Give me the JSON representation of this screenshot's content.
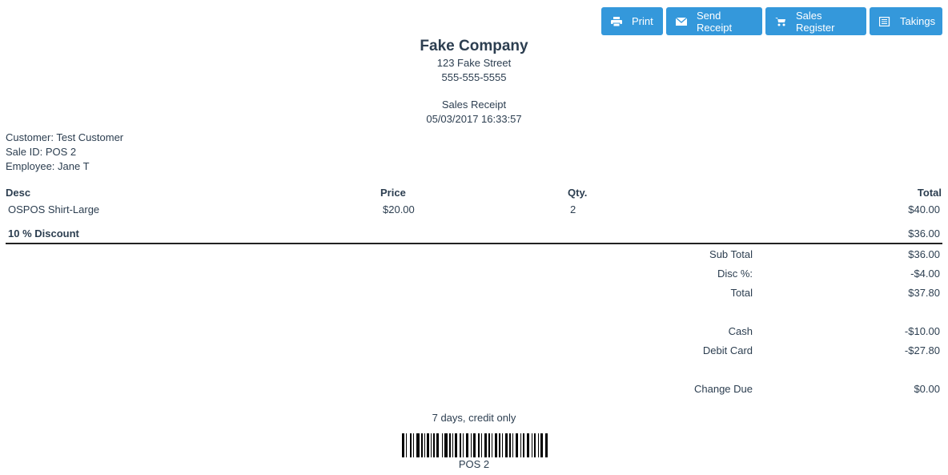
{
  "toolbar": {
    "print": {
      "label": "Print",
      "icon": "print-icon"
    },
    "send_receipt": {
      "label": "Send Receipt",
      "icon": "envelope-icon"
    },
    "sales_register": {
      "label": "Sales Register",
      "icon": "cart-icon"
    },
    "takings": {
      "label": "Takings",
      "icon": "list-icon"
    }
  },
  "company": {
    "name": "Fake Company",
    "address": "123 Fake Street",
    "phone": "555-555-5555"
  },
  "receipt": {
    "title": "Sales Receipt",
    "datetime": "05/03/2017 16:33:57"
  },
  "customer_info": {
    "customer": "Customer: Test Customer",
    "sale_id": "Sale ID: POS 2",
    "employee": "Employee: Jane T"
  },
  "table": {
    "headers": {
      "desc": "Desc",
      "price": "Price",
      "qty": "Qty.",
      "total": "Total"
    },
    "item": {
      "desc": "OSPOS Shirt-Large",
      "price": "$20.00",
      "qty": "2",
      "total": "$40.00"
    },
    "discount": {
      "label": "10 % Discount",
      "total": "$36.00"
    }
  },
  "totals": {
    "subtotal": {
      "label": "Sub Total",
      "value": "$36.00"
    },
    "disc": {
      "label": "Disc %:",
      "value": "-$4.00"
    },
    "total": {
      "label": "Total",
      "value": "$37.80"
    },
    "cash": {
      "label": "Cash",
      "value": "-$10.00"
    },
    "debit": {
      "label": "Debit Card",
      "value": "-$27.80"
    },
    "change": {
      "label": "Change Due",
      "value": "$0.00"
    }
  },
  "footer": {
    "return_policy": "7 days, credit only",
    "barcode_text": "POS 2"
  },
  "colors": {
    "button": "#3498db",
    "text": "#2c3e50"
  }
}
